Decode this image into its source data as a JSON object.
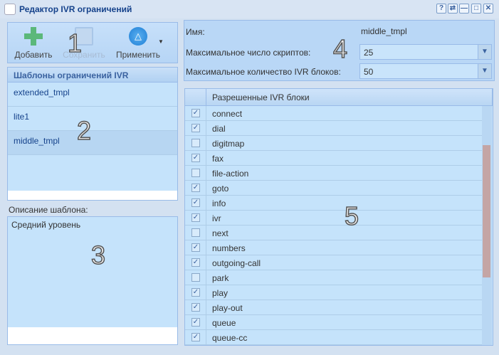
{
  "window": {
    "title": "Редактор IVR ограничений",
    "buttons": [
      "?",
      "⇄",
      "—",
      "□",
      "✕"
    ]
  },
  "toolbar": {
    "add": "Добавить",
    "save": "Сохранить",
    "apply": "Применить"
  },
  "templates": {
    "header": "Шаблоны ограничений IVR",
    "items": [
      "extended_tmpl",
      "lite1",
      "middle_tmpl"
    ],
    "selected": "middle_tmpl"
  },
  "description": {
    "label": "Описание шаблона:",
    "value": "Средний уровень"
  },
  "form": {
    "name_label": "Имя:",
    "name_value": "middle_tmpl",
    "max_scripts_label": "Максимальное число скриптов:",
    "max_scripts_value": "25",
    "max_blocks_label": "Максимальное количество IVR блоков:",
    "max_blocks_value": "50"
  },
  "grid": {
    "header": "Разрешенные IVR блоки",
    "rows": [
      {
        "name": "connect",
        "checked": true
      },
      {
        "name": "dial",
        "checked": true
      },
      {
        "name": "digitmap",
        "checked": false
      },
      {
        "name": "fax",
        "checked": true
      },
      {
        "name": "file-action",
        "checked": false
      },
      {
        "name": "goto",
        "checked": true
      },
      {
        "name": "info",
        "checked": true
      },
      {
        "name": "ivr",
        "checked": true
      },
      {
        "name": "next",
        "checked": false
      },
      {
        "name": "numbers",
        "checked": true
      },
      {
        "name": "outgoing-call",
        "checked": true
      },
      {
        "name": "park",
        "checked": false
      },
      {
        "name": "play",
        "checked": true
      },
      {
        "name": "play-out",
        "checked": true
      },
      {
        "name": "queue",
        "checked": true
      },
      {
        "name": "queue-cc",
        "checked": true
      }
    ]
  },
  "annotations": [
    "1",
    "2",
    "3",
    "4",
    "5"
  ]
}
